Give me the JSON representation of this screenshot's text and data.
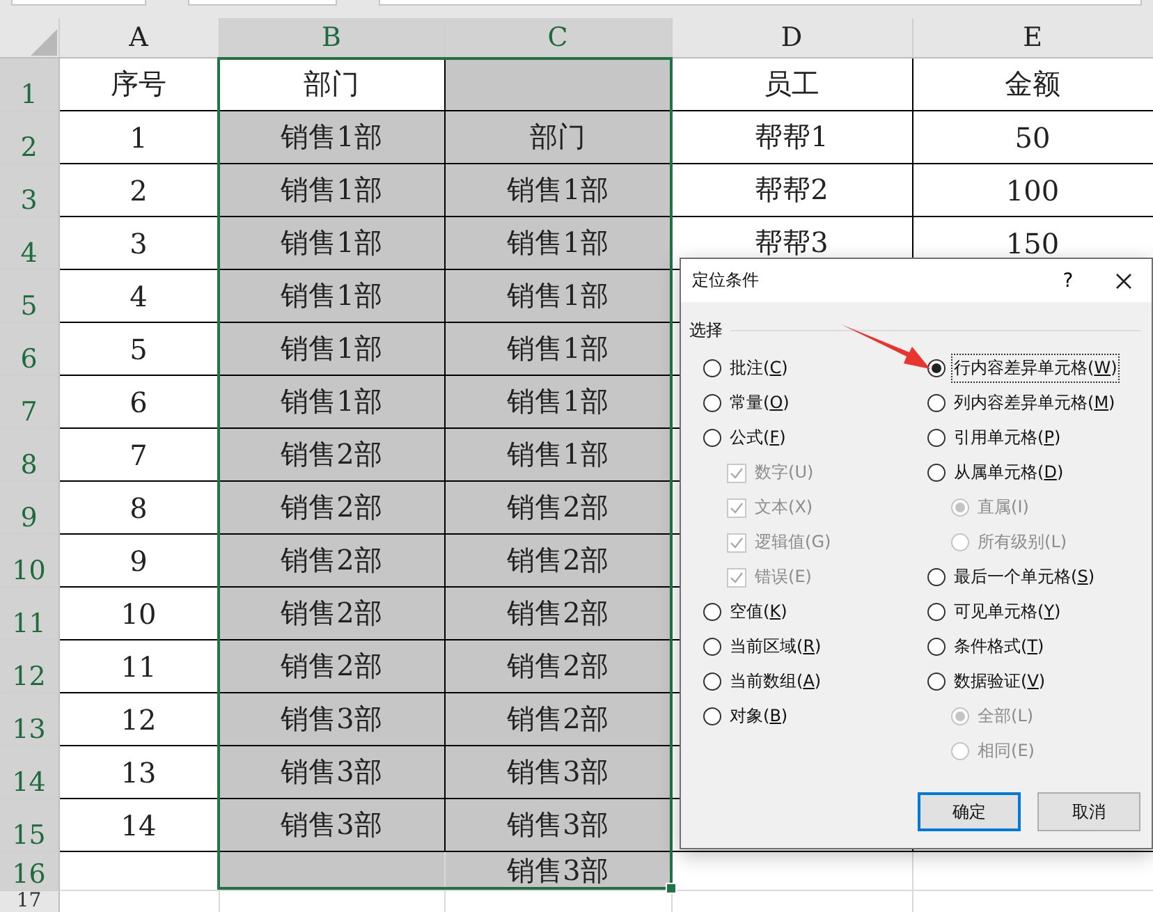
{
  "columns": [
    {
      "letter": "A",
      "selected": false
    },
    {
      "letter": "B",
      "selected": true
    },
    {
      "letter": "C",
      "selected": true
    },
    {
      "letter": "D",
      "selected": false
    },
    {
      "letter": "E",
      "selected": false
    }
  ],
  "rows": [
    {
      "number": "1",
      "selected": true,
      "cells": {
        "A": {
          "text": "序号",
          "selected": false
        },
        "B": {
          "text": "部门",
          "selected": false
        },
        "C": {
          "selected": true
        },
        "D": {
          "text": "员工",
          "selected": false
        },
        "E": {
          "text": "金额",
          "selected": false
        }
      }
    },
    {
      "number": "2",
      "selected": true,
      "cells": {
        "A": {
          "text": "1",
          "selected": false
        },
        "B": {
          "text": "销售1部",
          "selected": true
        },
        "C": {
          "text": "部门",
          "selected": true
        },
        "D": {
          "text": "帮帮1",
          "selected": false
        },
        "E": {
          "text": "50",
          "selected": false
        }
      }
    },
    {
      "number": "3",
      "selected": true,
      "cells": {
        "A": {
          "text": "2",
          "selected": false
        },
        "B": {
          "text": "销售1部",
          "selected": true
        },
        "C": {
          "text": "销售1部",
          "selected": true
        },
        "D": {
          "text": "帮帮2",
          "selected": false
        },
        "E": {
          "text": "100",
          "selected": false
        }
      }
    },
    {
      "number": "4",
      "selected": true,
      "cells": {
        "A": {
          "text": "3",
          "selected": false
        },
        "B": {
          "text": "销售1部",
          "selected": true
        },
        "C": {
          "text": "销售1部",
          "selected": true
        },
        "D": {
          "text": "帮帮3",
          "selected": false
        },
        "E": {
          "text": "150",
          "selected": false
        }
      }
    },
    {
      "number": "5",
      "selected": true,
      "cells": {
        "A": {
          "text": "4",
          "selected": false
        },
        "B": {
          "text": "销售1部",
          "selected": true
        },
        "C": {
          "text": "销售1部",
          "selected": true
        }
      }
    },
    {
      "number": "6",
      "selected": true,
      "cells": {
        "A": {
          "text": "5",
          "selected": false
        },
        "B": {
          "text": "销售1部",
          "selected": true
        },
        "C": {
          "text": "销售1部",
          "selected": true
        }
      }
    },
    {
      "number": "7",
      "selected": true,
      "cells": {
        "A": {
          "text": "6",
          "selected": false
        },
        "B": {
          "text": "销售1部",
          "selected": true
        },
        "C": {
          "text": "销售1部",
          "selected": true
        }
      }
    },
    {
      "number": "8",
      "selected": true,
      "cells": {
        "A": {
          "text": "7",
          "selected": false
        },
        "B": {
          "text": "销售2部",
          "selected": true
        },
        "C": {
          "text": "销售1部",
          "selected": true
        }
      }
    },
    {
      "number": "9",
      "selected": true,
      "cells": {
        "A": {
          "text": "8",
          "selected": false
        },
        "B": {
          "text": "销售2部",
          "selected": true
        },
        "C": {
          "text": "销售2部",
          "selected": true
        }
      }
    },
    {
      "number": "10",
      "selected": true,
      "cells": {
        "A": {
          "text": "9",
          "selected": false
        },
        "B": {
          "text": "销售2部",
          "selected": true
        },
        "C": {
          "text": "销售2部",
          "selected": true
        }
      }
    },
    {
      "number": "11",
      "selected": true,
      "cells": {
        "A": {
          "text": "10",
          "selected": false
        },
        "B": {
          "text": "销售2部",
          "selected": true
        },
        "C": {
          "text": "销售2部",
          "selected": true
        }
      }
    },
    {
      "number": "12",
      "selected": true,
      "cells": {
        "A": {
          "text": "11",
          "selected": false
        },
        "B": {
          "text": "销售2部",
          "selected": true
        },
        "C": {
          "text": "销售2部",
          "selected": true
        }
      }
    },
    {
      "number": "13",
      "selected": true,
      "cells": {
        "A": {
          "text": "12",
          "selected": false
        },
        "B": {
          "text": "销售3部",
          "selected": true
        },
        "C": {
          "text": "销售2部",
          "selected": true
        }
      }
    },
    {
      "number": "14",
      "selected": true,
      "cells": {
        "A": {
          "text": "13",
          "selected": false
        },
        "B": {
          "text": "销售3部",
          "selected": true
        },
        "C": {
          "text": "销售3部",
          "selected": true
        }
      }
    },
    {
      "number": "15",
      "selected": true,
      "cells": {
        "A": {
          "text": "14",
          "selected": false
        },
        "B": {
          "text": "销售3部",
          "selected": true
        },
        "C": {
          "text": "销售3部",
          "selected": true
        }
      }
    },
    {
      "number": "16",
      "selected": true,
      "cells": {
        "B": {
          "selected": true
        },
        "C": {
          "text": "销售3部",
          "selected": true
        }
      }
    },
    {
      "number": "17",
      "selected": false,
      "cells": {}
    }
  ],
  "dialog": {
    "title": "定位条件",
    "help": "?",
    "section": "选择",
    "left": [
      {
        "kind": "radio",
        "label": "批注(C)",
        "selected": false,
        "disabled": false
      },
      {
        "kind": "radio",
        "label": "常量(O)",
        "selected": false,
        "disabled": false
      },
      {
        "kind": "radio",
        "label": "公式(F)",
        "selected": false,
        "disabled": false,
        "children": [
          {
            "kind": "checkbox",
            "label": "数字(U)",
            "checked": true,
            "disabled": true
          },
          {
            "kind": "checkbox",
            "label": "文本(X)",
            "checked": true,
            "disabled": true
          },
          {
            "kind": "checkbox",
            "label": "逻辑值(G)",
            "checked": true,
            "disabled": true
          },
          {
            "kind": "checkbox",
            "label": "错误(E)",
            "checked": true,
            "disabled": true
          }
        ]
      },
      {
        "kind": "radio",
        "label": "空值(K)",
        "selected": false,
        "disabled": false
      },
      {
        "kind": "radio",
        "label": "当前区域(R)",
        "selected": false,
        "disabled": false
      },
      {
        "kind": "radio",
        "label": "当前数组(A)",
        "selected": false,
        "disabled": false
      },
      {
        "kind": "radio",
        "label": "对象(B)",
        "selected": false,
        "disabled": false
      }
    ],
    "right": [
      {
        "kind": "radio",
        "label": "行内容差异单元格(W)",
        "selected": true,
        "disabled": false,
        "focused": true
      },
      {
        "kind": "radio",
        "label": "列内容差异单元格(M)",
        "selected": false,
        "disabled": false
      },
      {
        "kind": "radio",
        "label": "引用单元格(P)",
        "selected": false,
        "disabled": false
      },
      {
        "kind": "radio",
        "label": "从属单元格(D)",
        "selected": false,
        "disabled": false,
        "children": [
          {
            "kind": "radio",
            "label": "直属(I)",
            "selected": true,
            "disabled": true
          },
          {
            "kind": "radio",
            "label": "所有级别(L)",
            "selected": false,
            "disabled": true
          }
        ]
      },
      {
        "kind": "radio",
        "label": "最后一个单元格(S)",
        "selected": false,
        "disabled": false
      },
      {
        "kind": "radio",
        "label": "可见单元格(Y)",
        "selected": false,
        "disabled": false
      },
      {
        "kind": "radio",
        "label": "条件格式(T)",
        "selected": false,
        "disabled": false
      },
      {
        "kind": "radio",
        "label": "数据验证(V)",
        "selected": false,
        "disabled": false,
        "children": [
          {
            "kind": "radio",
            "label": "全部(L)",
            "selected": true,
            "disabled": true
          },
          {
            "kind": "radio",
            "label": "相同(E)",
            "selected": false,
            "disabled": true
          }
        ]
      }
    ],
    "buttons": [
      {
        "label": "确定",
        "default": true
      },
      {
        "label": "取消",
        "default": false
      }
    ]
  }
}
